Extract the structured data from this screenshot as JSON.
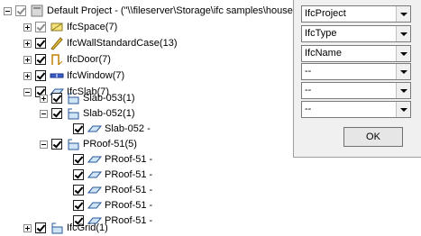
{
  "tree": {
    "root": {
      "label": "Default Project - (\"\\\\fileserver\\Storage\\ifc samples\\house",
      "icon": "project-icon"
    },
    "nodes": [
      {
        "label": "IfcSpace(7)",
        "icon": "ifc-space-icon"
      },
      {
        "label": "IfcWallStandardCase(13)",
        "icon": "ifc-wall-icon"
      },
      {
        "label": "IfcDoor(7)",
        "icon": "ifc-door-icon"
      },
      {
        "label": "IfcWindow(7)",
        "icon": "ifc-window-icon"
      },
      {
        "label": "IfcSlab(7)",
        "icon": "ifc-slab-icon"
      },
      {
        "label": "Slab-053(1)",
        "icon": "ifc-storey-icon"
      },
      {
        "label": "Slab-052(1)",
        "icon": "ifc-storey-icon"
      },
      {
        "label": "Slab-052 -",
        "icon": "ifc-slab-icon"
      },
      {
        "label": "PRoof-51(5)",
        "icon": "ifc-storey-icon"
      },
      {
        "label": "PRoof-51 -",
        "icon": "ifc-slab-icon"
      },
      {
        "label": "PRoof-51 -",
        "icon": "ifc-slab-icon"
      },
      {
        "label": "PRoof-51 -",
        "icon": "ifc-slab-icon"
      },
      {
        "label": "PRoof-51 -",
        "icon": "ifc-slab-icon"
      },
      {
        "label": "PRoof-51 -",
        "icon": "ifc-slab-icon"
      },
      {
        "label": "IfcGrid(1)",
        "icon": "ifc-grid-icon"
      }
    ]
  },
  "panel": {
    "combos": [
      {
        "value": "IfcProject"
      },
      {
        "value": "IfcType"
      },
      {
        "value": "IfcName"
      },
      {
        "value": "--"
      },
      {
        "value": "--"
      },
      {
        "value": "--"
      }
    ],
    "ok_label": "OK"
  }
}
